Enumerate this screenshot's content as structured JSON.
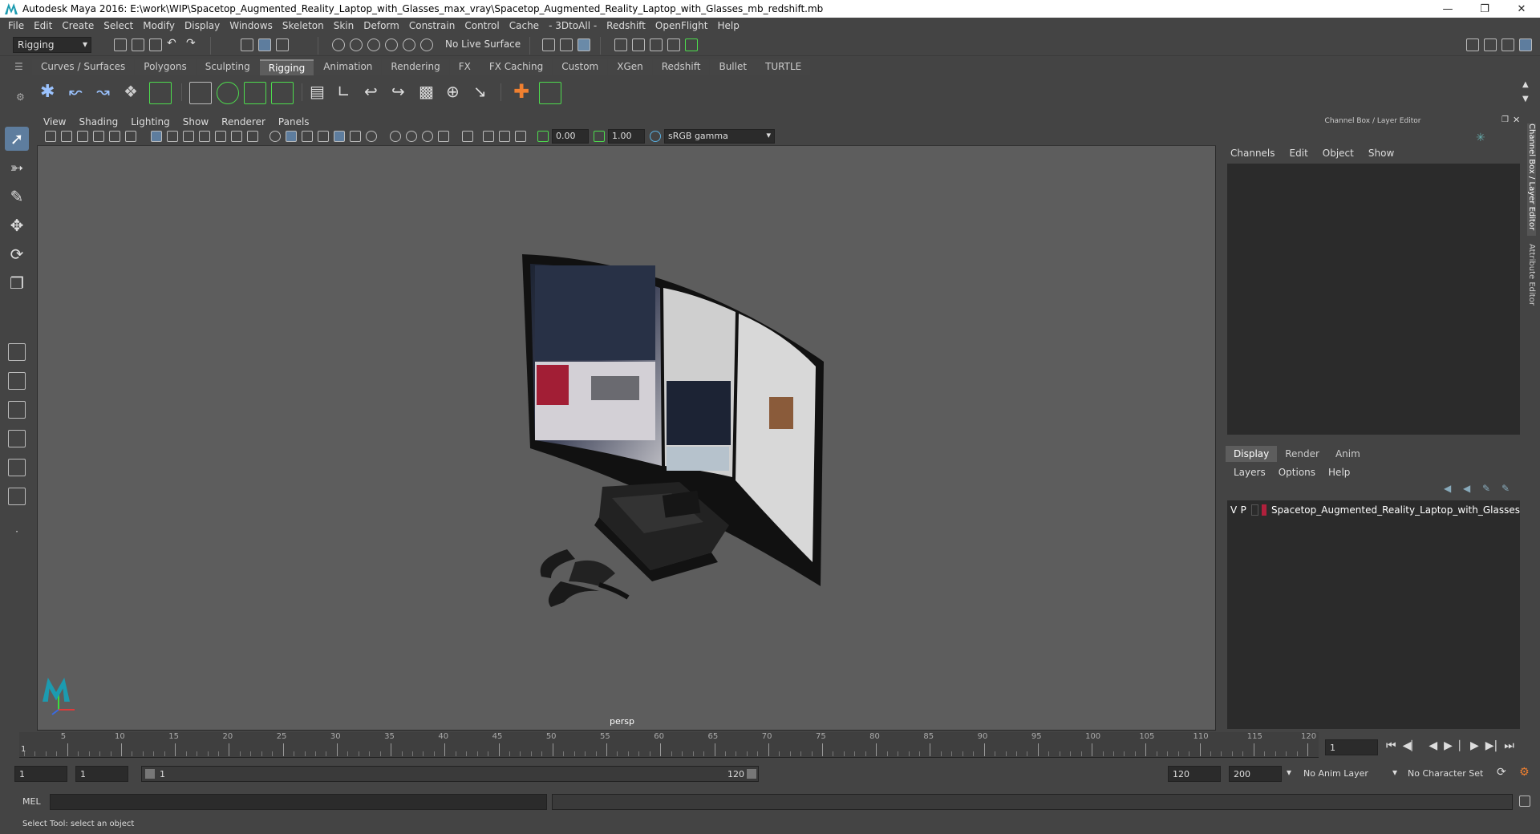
{
  "window": {
    "title": "Autodesk Maya 2016: E:\\work\\WIP\\Spacetop_Augmented_Reality_Laptop_with_Glasses_max_vray\\Spacetop_Augmented_Reality_Laptop_with_Glasses_mb_redshift.mb",
    "min_icon": "minimize-icon",
    "max_icon": "restore-icon",
    "close_icon": "close-icon"
  },
  "menubar": [
    "File",
    "Edit",
    "Create",
    "Select",
    "Modify",
    "Display",
    "Windows",
    "Skeleton",
    "Skin",
    "Deform",
    "Constrain",
    "Control",
    "Cache",
    "- 3DtoAll -",
    "Redshift",
    "OpenFlight",
    "Help"
  ],
  "toolbar": {
    "menuset": "Rigging",
    "live_surface": "No Live Surface"
  },
  "shelf_tabs": [
    "Curves / Surfaces",
    "Polygons",
    "Sculpting",
    "Rigging",
    "Animation",
    "Rendering",
    "FX",
    "FX Caching",
    "Custom",
    "XGen",
    "Redshift",
    "Bullet",
    "TURTLE"
  ],
  "active_shelf_tab": "Rigging",
  "viewport": {
    "menu": [
      "View",
      "Shading",
      "Lighting",
      "Show",
      "Renderer",
      "Panels"
    ],
    "exposure": "0.00",
    "gamma": "1.00",
    "colorspace": "sRGB gamma",
    "camera_label": "persp"
  },
  "channel_box": {
    "title": "Channel Box / Layer Editor",
    "menu": [
      "Channels",
      "Edit",
      "Object",
      "Show"
    ]
  },
  "layer_editor": {
    "tabs": [
      "Display",
      "Render",
      "Anim"
    ],
    "active_tab": "Display",
    "menu": [
      "Layers",
      "Options",
      "Help"
    ],
    "layers": [
      {
        "v": "V",
        "p": "P",
        "color": "#b0203c",
        "name": "Spacetop_Augmented_Reality_Laptop_with_Glasses"
      }
    ]
  },
  "side_tabs": [
    "Channel Box / Layer Editor",
    "Attribute Editor"
  ],
  "timeline": {
    "ticks": [
      "5",
      "10",
      "15",
      "20",
      "25",
      "30",
      "35",
      "40",
      "45",
      "50",
      "55",
      "60",
      "65",
      "70",
      "75",
      "80",
      "85",
      "90",
      "95",
      "100",
      "105",
      "110",
      "115",
      "120"
    ],
    "start_frame_label": "1",
    "current_frame": "1"
  },
  "range": {
    "start": "1",
    "playback_start": "1",
    "slider_start": "1",
    "slider_end": "120",
    "playback_end": "120",
    "end": "200",
    "anim_layer": "No Anim Layer",
    "char_set": "No Character Set"
  },
  "command_line": {
    "label": "MEL"
  },
  "status": "Select Tool: select an object"
}
